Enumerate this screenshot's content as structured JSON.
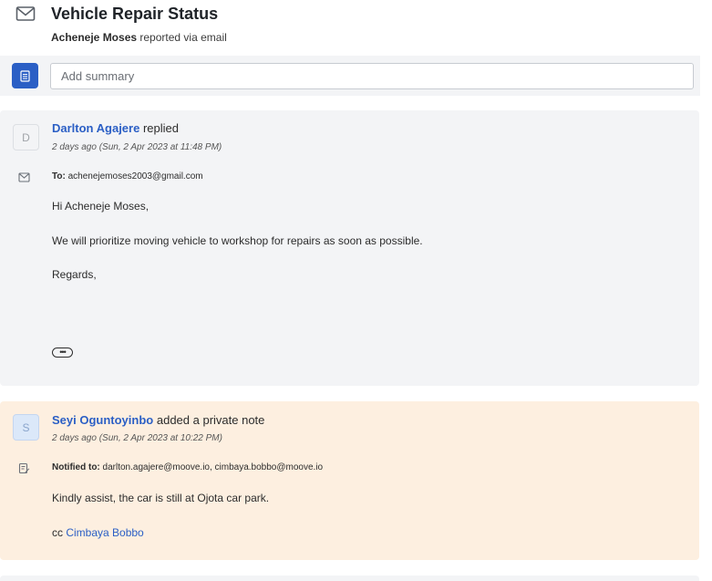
{
  "ticket": {
    "title": "Vehicle Repair Status",
    "reporter_name": "Acheneje Moses",
    "reporter_suffix": "reported via email",
    "summary_placeholder": "Add summary"
  },
  "reply": {
    "avatar_letter": "D",
    "author": "Darlton Agajere",
    "action": "replied",
    "time": "2 days ago (Sun, 2 Apr 2023 at 11:48 PM)",
    "to_label": "To:",
    "to_value": "achenejemoses2003@gmail.com",
    "greeting": "Hi Acheneje Moses,",
    "message": "We will prioritize moving vehicle to workshop for repairs as soon as possible.",
    "closing": "Regards,",
    "more_label": "•••"
  },
  "note": {
    "avatar_letter": "S",
    "author": "Seyi Oguntoyinbo",
    "action": "added a private note",
    "time": "2 days ago (Sun, 2 Apr 2023 at 10:22 PM)",
    "notified_label": "Notified to:",
    "notified_value": "darlton.agajere@moove.io, cimbaya.bobbo@moove.io",
    "message": "Kindly assist, the car is still at Ojota car park.",
    "cc_prefix": "cc",
    "cc_name": "Cimbaya Bobbo"
  },
  "icons": {
    "header": "envelope-icon",
    "summary": "document-icon",
    "reply_meta": "envelope-icon",
    "note_meta": "note-edit-icon"
  },
  "colors": {
    "accent": "#2b5fc5",
    "reply_bg": "#f3f4f6",
    "note_bg": "#fdefe0",
    "avatar_s_bg": "#dbe8f9"
  }
}
